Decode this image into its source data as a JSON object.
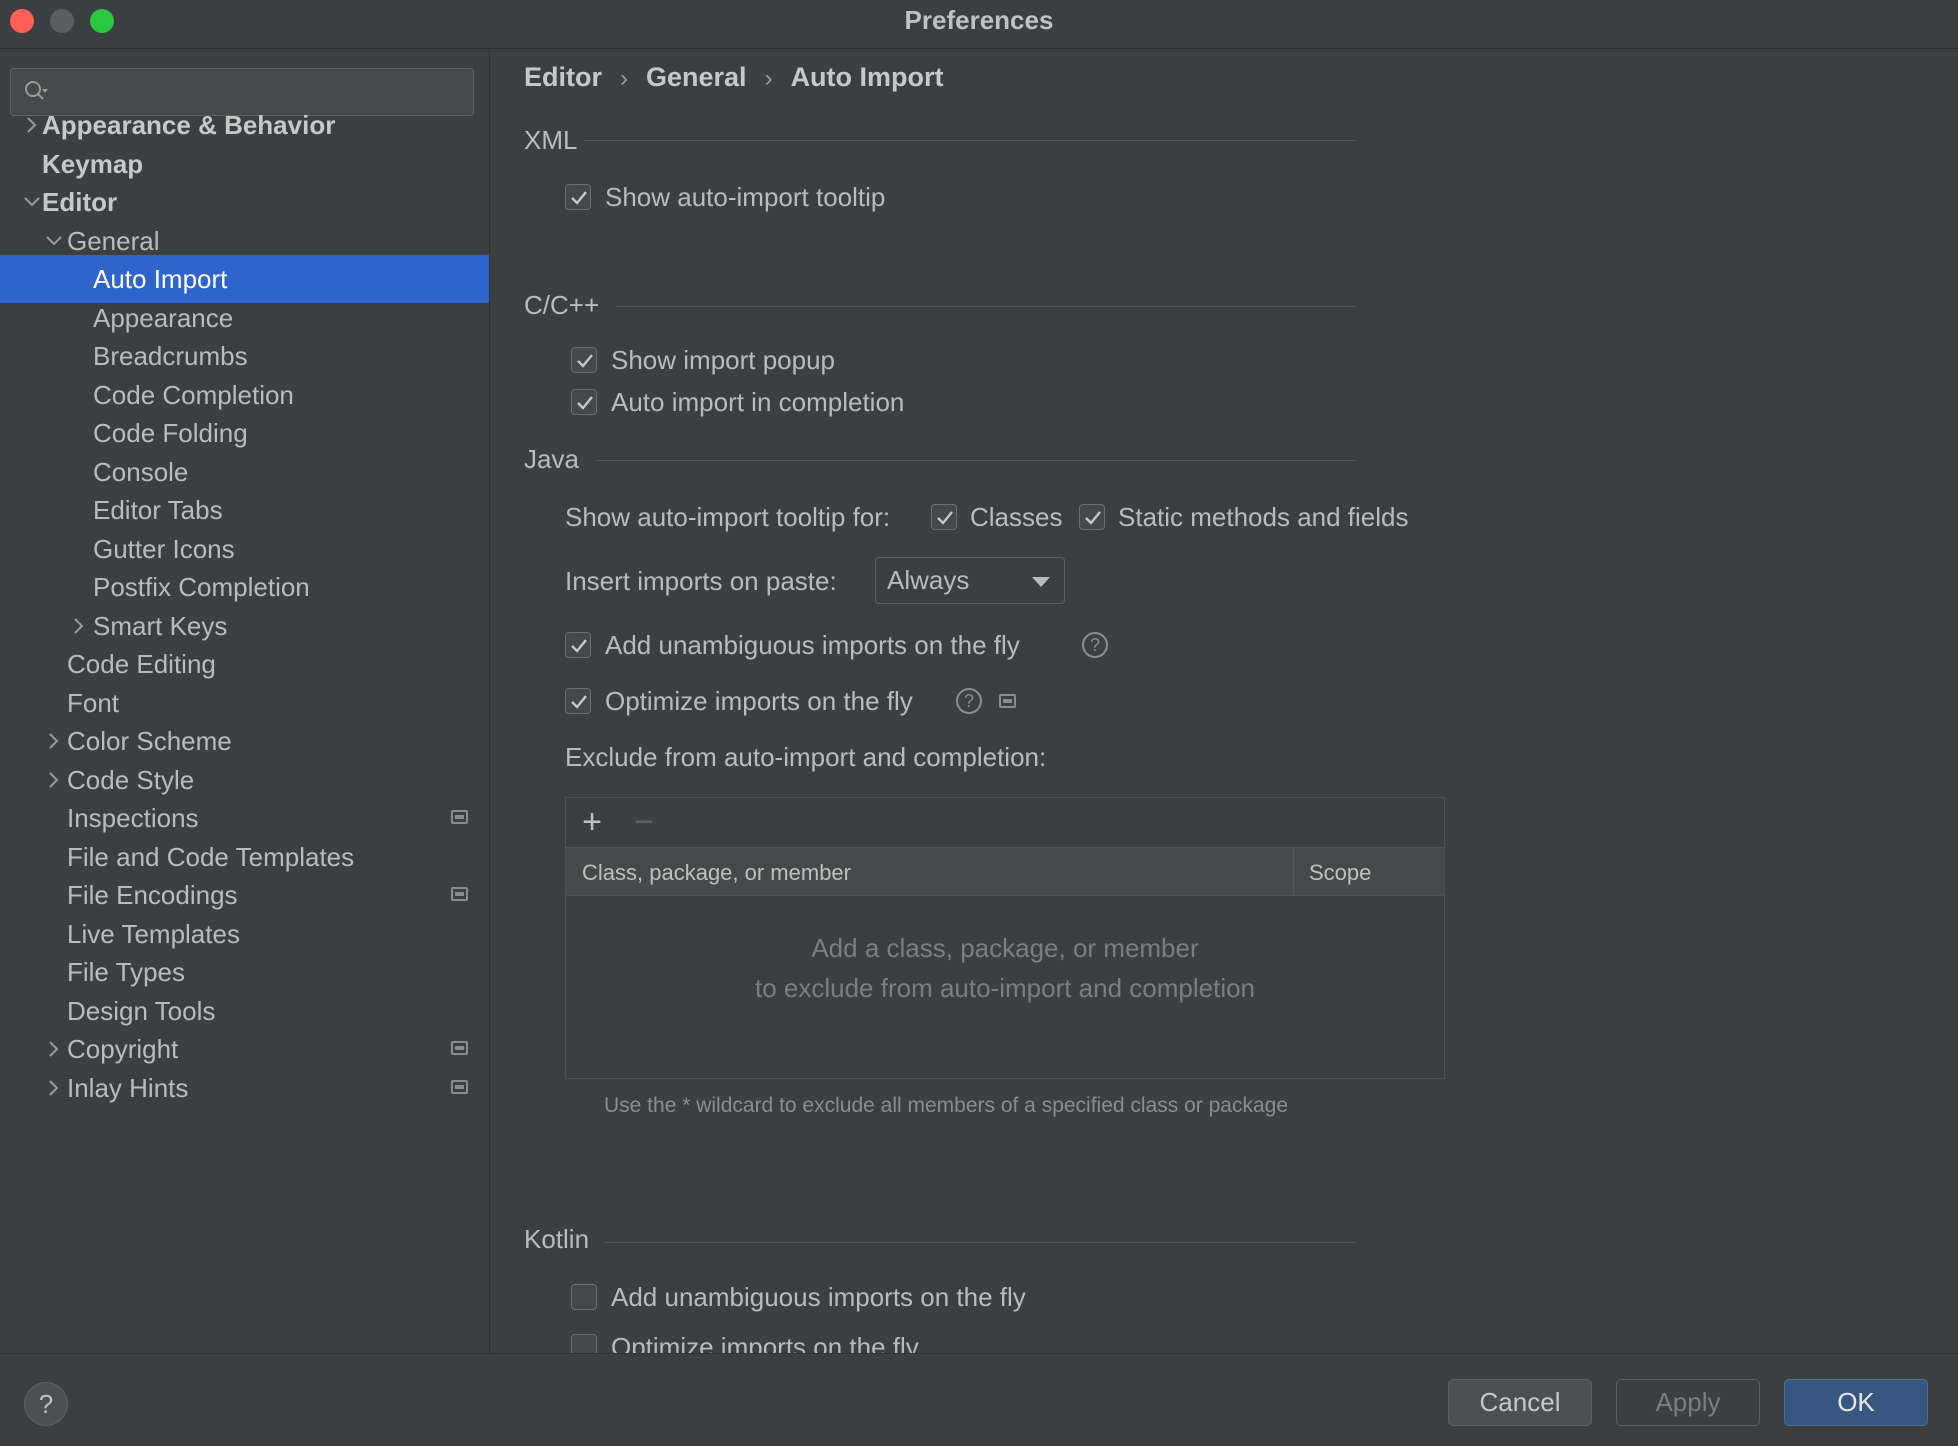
{
  "window": {
    "title": "Preferences"
  },
  "search": {
    "placeholder": ""
  },
  "sidebar": {
    "items": [
      {
        "label": "Appearance & Behavior",
        "level": 0,
        "expander": "collapsed",
        "bold": true,
        "badge": false
      },
      {
        "label": "Keymap",
        "level": 0,
        "expander": "none",
        "bold": true,
        "badge": false
      },
      {
        "label": "Editor",
        "level": 0,
        "expander": "expanded",
        "bold": true,
        "badge": false
      },
      {
        "label": "General",
        "level": 1,
        "expander": "expanded",
        "bold": false,
        "badge": false
      },
      {
        "label": "Auto Import",
        "level": 2,
        "expander": "none",
        "bold": false,
        "badge": false,
        "selected": true
      },
      {
        "label": "Appearance",
        "level": 2,
        "expander": "none",
        "bold": false,
        "badge": false
      },
      {
        "label": "Breadcrumbs",
        "level": 2,
        "expander": "none",
        "bold": false,
        "badge": false
      },
      {
        "label": "Code Completion",
        "level": 2,
        "expander": "none",
        "bold": false,
        "badge": false
      },
      {
        "label": "Code Folding",
        "level": 2,
        "expander": "none",
        "bold": false,
        "badge": false
      },
      {
        "label": "Console",
        "level": 2,
        "expander": "none",
        "bold": false,
        "badge": false
      },
      {
        "label": "Editor Tabs",
        "level": 2,
        "expander": "none",
        "bold": false,
        "badge": false
      },
      {
        "label": "Gutter Icons",
        "level": 2,
        "expander": "none",
        "bold": false,
        "badge": false
      },
      {
        "label": "Postfix Completion",
        "level": 2,
        "expander": "none",
        "bold": false,
        "badge": false
      },
      {
        "label": "Smart Keys",
        "level": 2,
        "expander": "collapsed",
        "bold": false,
        "badge": false
      },
      {
        "label": "Code Editing",
        "level": 1,
        "expander": "none",
        "bold": false,
        "badge": false
      },
      {
        "label": "Font",
        "level": 1,
        "expander": "none",
        "bold": false,
        "badge": false
      },
      {
        "label": "Color Scheme",
        "level": 1,
        "expander": "collapsed",
        "bold": false,
        "badge": false
      },
      {
        "label": "Code Style",
        "level": 1,
        "expander": "collapsed",
        "bold": false,
        "badge": false
      },
      {
        "label": "Inspections",
        "level": 1,
        "expander": "none",
        "bold": false,
        "badge": true
      },
      {
        "label": "File and Code Templates",
        "level": 1,
        "expander": "none",
        "bold": false,
        "badge": false
      },
      {
        "label": "File Encodings",
        "level": 1,
        "expander": "none",
        "bold": false,
        "badge": true
      },
      {
        "label": "Live Templates",
        "level": 1,
        "expander": "none",
        "bold": false,
        "badge": false
      },
      {
        "label": "File Types",
        "level": 1,
        "expander": "none",
        "bold": false,
        "badge": false
      },
      {
        "label": "Design Tools",
        "level": 1,
        "expander": "none",
        "bold": false,
        "badge": false
      },
      {
        "label": "Copyright",
        "level": 1,
        "expander": "collapsed",
        "bold": false,
        "badge": true
      },
      {
        "label": "Inlay Hints",
        "level": 1,
        "expander": "collapsed",
        "bold": false,
        "badge": true
      }
    ]
  },
  "breadcrumb": [
    "Editor",
    "General",
    "Auto Import"
  ],
  "xml": {
    "title": "XML",
    "show_tooltip": {
      "label": "Show auto-import tooltip",
      "checked": true
    }
  },
  "cpp": {
    "title": "C/C++",
    "show_popup": {
      "label": "Show import popup",
      "checked": true
    },
    "auto_import_completion": {
      "label": "Auto import in completion",
      "checked": true
    }
  },
  "java": {
    "title": "Java",
    "tooltip_for_label": "Show auto-import tooltip for:",
    "classes": {
      "label": "Classes",
      "checked": true
    },
    "static_members": {
      "label": "Static methods and fields",
      "checked": true
    },
    "paste_label": "Insert imports on paste:",
    "paste_value": "Always",
    "add_unambiguous": {
      "label": "Add unambiguous imports on the fly",
      "checked": true
    },
    "optimize": {
      "label": "Optimize imports on the fly",
      "checked": true
    },
    "exclude_label": "Exclude from auto-import and completion:",
    "table": {
      "add": "+",
      "remove": "−",
      "columns": [
        "Class, package, or member",
        "Scope"
      ],
      "empty_line1": "Add a class, package, or member",
      "empty_line2": "to exclude from auto-import and completion"
    },
    "hint": "Use the * wildcard to exclude all members of a specified class or package"
  },
  "kotlin": {
    "title": "Kotlin",
    "add_unambiguous": {
      "label": "Add unambiguous imports on the fly",
      "checked": false
    },
    "optimize": {
      "label": "Optimize imports on the fly",
      "checked": false
    }
  },
  "footer": {
    "help": "?",
    "cancel": "Cancel",
    "apply": "Apply",
    "ok": "OK"
  },
  "colors": {
    "selection": "#2f65ca",
    "ok_button": "#365880",
    "background": "#3c3f41"
  }
}
